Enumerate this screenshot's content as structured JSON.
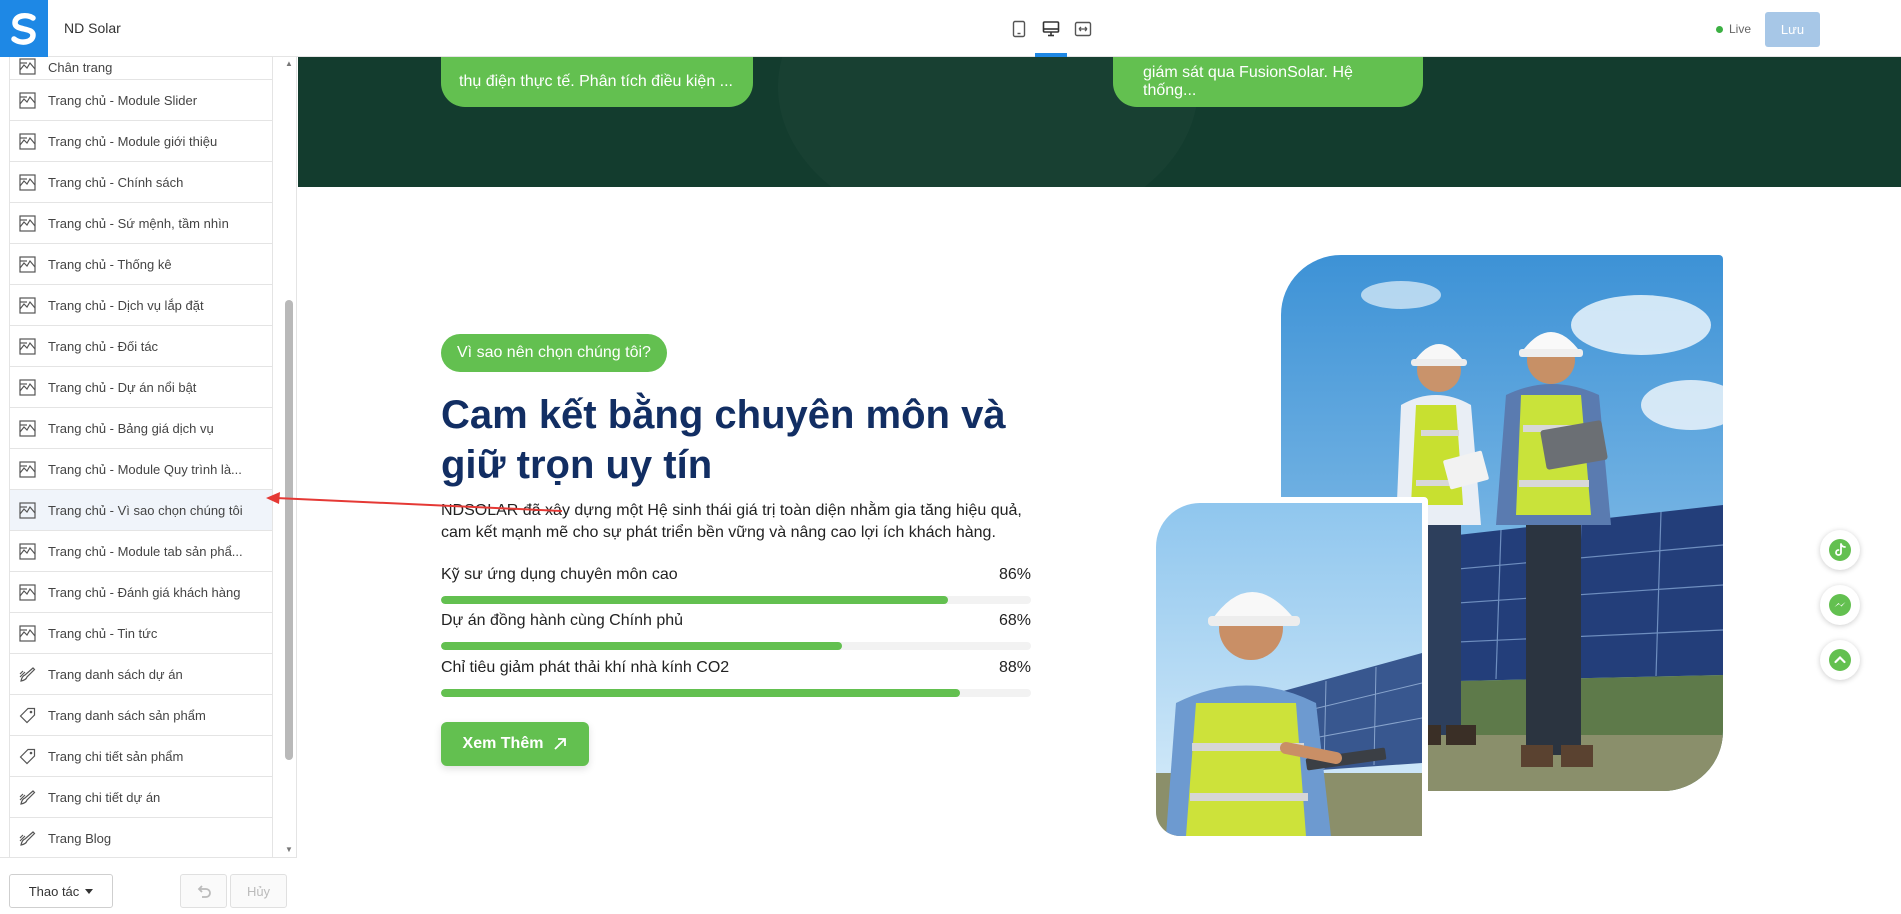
{
  "app": {
    "site_name": "ND Solar",
    "live_label": "Live",
    "save_label": "Lưu"
  },
  "device_modes": [
    "tablet-icon",
    "desktop-icon",
    "fullwidth-icon"
  ],
  "sidebar": {
    "items": [
      {
        "label": "Chân trang",
        "icon": "layout-icon"
      },
      {
        "label": "Trang chủ - Module Slider",
        "icon": "layout-icon"
      },
      {
        "label": "Trang chủ - Module giới thiệu",
        "icon": "layout-icon"
      },
      {
        "label": "Trang chủ - Chính sách",
        "icon": "layout-icon"
      },
      {
        "label": "Trang chủ - Sứ mệnh, tầm nhìn",
        "icon": "layout-icon"
      },
      {
        "label": "Trang chủ - Thống kê",
        "icon": "layout-icon"
      },
      {
        "label": "Trang chủ - Dịch vụ lắp đặt",
        "icon": "layout-icon"
      },
      {
        "label": "Trang chủ - Đối tác",
        "icon": "layout-icon"
      },
      {
        "label": "Trang chủ - Dự án nổi bật",
        "icon": "layout-icon"
      },
      {
        "label": "Trang chủ - Bảng giá dịch vụ",
        "icon": "layout-icon"
      },
      {
        "label": "Trang chủ - Module Quy trình là...",
        "icon": "layout-icon"
      },
      {
        "label": "Trang chủ - Vì sao chọn chúng tôi",
        "icon": "layout-icon"
      },
      {
        "label": "Trang chủ - Module tab sản phẩ...",
        "icon": "layout-icon"
      },
      {
        "label": "Trang chủ - Đánh giá khách hàng",
        "icon": "layout-icon"
      },
      {
        "label": "Trang chủ - Tin tức",
        "icon": "layout-icon"
      },
      {
        "label": "Trang danh sách dự án",
        "icon": "brush-icon"
      },
      {
        "label": "Trang danh sách sản phẩm",
        "icon": "tag-icon"
      },
      {
        "label": "Trang chi tiết sản phẩm",
        "icon": "tag-icon"
      },
      {
        "label": "Trang chi tiết dự án",
        "icon": "brush-icon"
      },
      {
        "label": "Trang Blog",
        "icon": "brush-icon"
      }
    ],
    "active_index": 11,
    "footer": {
      "actions_label": "Thao tác",
      "cancel_label": "Hủy"
    }
  },
  "preview": {
    "top_pills": [
      "thụ điện thực tế. Phân tích điều kiện ...",
      "giám sát qua FusionSolar. Hệ thống..."
    ],
    "tagline": "Vì sao nên chọn chúng tôi?",
    "heading": "Cam kết bằng chuyên môn và giữ trọn uy tín",
    "description": "NDSOLAR đã xây dựng một Hệ sinh thái giá trị toàn diện nhằm gia tăng hiệu quả, cam kết mạnh mẽ cho sự phát triển bền vững và nâng cao lợi ích khách hàng.",
    "bars": [
      {
        "label": "Kỹ sư ứng dụng chuyên môn cao",
        "value_label": "86%",
        "value": 86
      },
      {
        "label": "Dự án đồng hành cùng Chính phủ",
        "value_label": "68%",
        "value": 68
      },
      {
        "label": "Chỉ tiêu giảm phát thải khí nhà kính CO2",
        "value_label": "88%",
        "value": 88
      }
    ],
    "cta_label": "Xem Thêm",
    "floating": [
      "tiktok-icon",
      "messenger-icon",
      "scroll-top-icon"
    ]
  },
  "colors": {
    "accent": "#63c050",
    "dark": "#133c2e",
    "heading": "#122e63",
    "brand": "#1e88e5",
    "annotation": "#e53935"
  }
}
